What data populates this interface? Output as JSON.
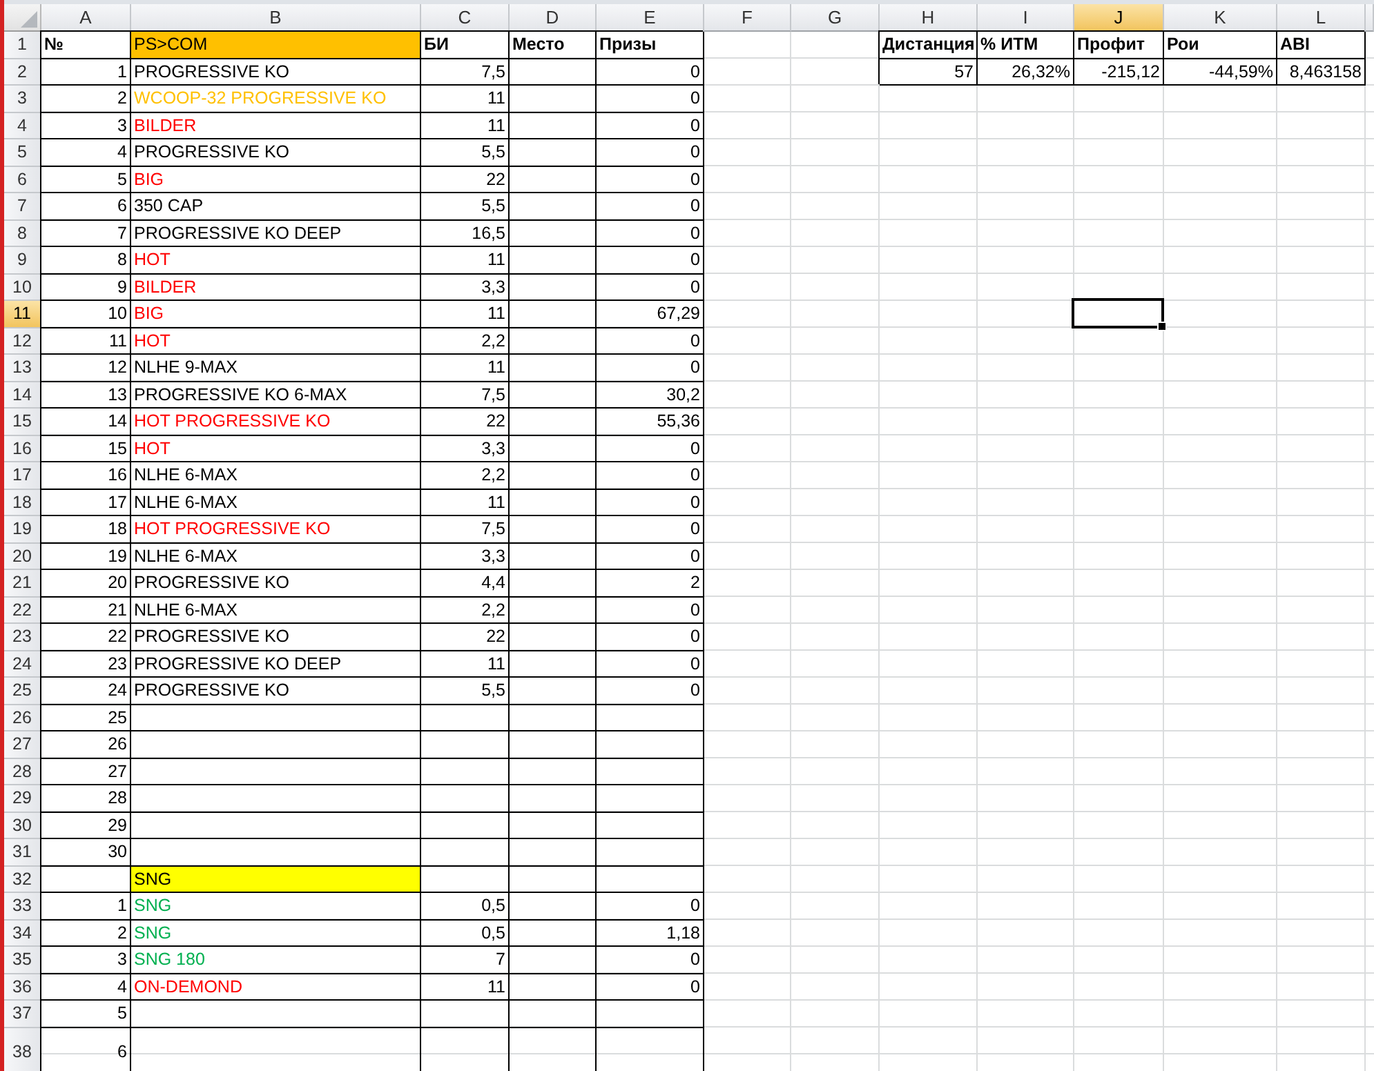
{
  "columns": [
    {
      "label": "A",
      "selected": false
    },
    {
      "label": "B",
      "selected": false
    },
    {
      "label": "C",
      "selected": false
    },
    {
      "label": "D",
      "selected": false
    },
    {
      "label": "E",
      "selected": false
    },
    {
      "label": "F",
      "selected": false
    },
    {
      "label": "G",
      "selected": false
    },
    {
      "label": "H",
      "selected": false
    },
    {
      "label": "I",
      "selected": false
    },
    {
      "label": "J",
      "selected": true
    },
    {
      "label": "K",
      "selected": false
    },
    {
      "label": "L",
      "selected": false
    }
  ],
  "rows": [
    {
      "number": "1",
      "selected": false,
      "cells": [
        {
          "text": "№",
          "kind": "text",
          "bold": true,
          "bordered": true
        },
        {
          "text": "PS>COM",
          "kind": "highlight",
          "color": "#ffc000",
          "bordered": true
        },
        {
          "text": "БИ",
          "kind": "text",
          "bold": true,
          "bordered": true
        },
        {
          "text": "Место",
          "kind": "text",
          "bold": true,
          "bordered": true
        },
        {
          "text": "Призы",
          "kind": "text",
          "bold": true,
          "bordered": true
        },
        {},
        {},
        {
          "text": "Дистанция",
          "kind": "text",
          "bold": true,
          "bordered": true
        },
        {
          "text": "% ИТМ",
          "kind": "text",
          "bold": true,
          "bordered": true
        },
        {
          "text": "Профит",
          "kind": "text",
          "bold": true,
          "bordered": true
        },
        {
          "text": "Рои",
          "kind": "text",
          "bold": true,
          "bordered": true
        },
        {
          "text": "ABI",
          "kind": "text",
          "bold": true,
          "bordered": true
        }
      ]
    },
    {
      "number": "2",
      "selected": false,
      "cells": [
        {
          "text": "1",
          "kind": "number",
          "bordered": true
        },
        {
          "text": "PROGRESSIVE KO",
          "kind": "text",
          "bordered": true
        },
        {
          "text": "7,5",
          "kind": "number",
          "bordered": true
        },
        {
          "bordered": true
        },
        {
          "text": "0",
          "kind": "number",
          "bordered": true
        },
        {},
        {},
        {
          "text": "57",
          "kind": "number",
          "bordered": true
        },
        {
          "text": "26,32%",
          "kind": "number",
          "bordered": true
        },
        {
          "text": "-215,12",
          "kind": "number",
          "bordered": true
        },
        {
          "text": "-44,59%",
          "kind": "number",
          "bordered": true
        },
        {
          "text": "8,463158",
          "kind": "number",
          "bordered": true
        }
      ]
    },
    {
      "number": "3",
      "selected": false,
      "cells": [
        {
          "text": "2",
          "kind": "number",
          "bordered": true
        },
        {
          "text": "WCOOP-32 PROGRESSIVE KO",
          "kind": "text",
          "color": "#ffc000",
          "bordered": true
        },
        {
          "text": "11",
          "kind": "number",
          "bordered": true
        },
        {
          "bordered": true
        },
        {
          "text": "0",
          "kind": "number",
          "bordered": true
        }
      ]
    },
    {
      "number": "4",
      "selected": false,
      "cells": [
        {
          "text": "3",
          "kind": "number",
          "bordered": true
        },
        {
          "text": "BILDER",
          "kind": "text",
          "color": "#ff0000",
          "bordered": true
        },
        {
          "text": "11",
          "kind": "number",
          "bordered": true
        },
        {
          "bordered": true
        },
        {
          "text": "0",
          "kind": "number",
          "bordered": true
        }
      ]
    },
    {
      "number": "5",
      "selected": false,
      "cells": [
        {
          "text": "4",
          "kind": "number",
          "bordered": true
        },
        {
          "text": "PROGRESSIVE KO",
          "kind": "text",
          "bordered": true
        },
        {
          "text": "5,5",
          "kind": "number",
          "bordered": true
        },
        {
          "bordered": true
        },
        {
          "text": "0",
          "kind": "number",
          "bordered": true
        }
      ]
    },
    {
      "number": "6",
      "selected": false,
      "cells": [
        {
          "text": "5",
          "kind": "number",
          "bordered": true
        },
        {
          "text": "BIG",
          "kind": "text",
          "color": "#ff0000",
          "bordered": true
        },
        {
          "text": "22",
          "kind": "number",
          "bordered": true
        },
        {
          "bordered": true
        },
        {
          "text": "0",
          "kind": "number",
          "bordered": true
        }
      ]
    },
    {
      "number": "7",
      "selected": false,
      "cells": [
        {
          "text": "6",
          "kind": "number",
          "bordered": true
        },
        {
          "text": "350 CAP",
          "kind": "text",
          "bordered": true
        },
        {
          "text": "5,5",
          "kind": "number",
          "bordered": true
        },
        {
          "bordered": true
        },
        {
          "text": "0",
          "kind": "number",
          "bordered": true
        }
      ]
    },
    {
      "number": "8",
      "selected": false,
      "cells": [
        {
          "text": "7",
          "kind": "number",
          "bordered": true
        },
        {
          "text": "PROGRESSIVE KO DEEP",
          "kind": "text",
          "bordered": true
        },
        {
          "text": "16,5",
          "kind": "number",
          "bordered": true
        },
        {
          "bordered": true
        },
        {
          "text": "0",
          "kind": "number",
          "bordered": true
        }
      ]
    },
    {
      "number": "9",
      "selected": false,
      "cells": [
        {
          "text": "8",
          "kind": "number",
          "bordered": true
        },
        {
          "text": "HOT",
          "kind": "text",
          "color": "#ff0000",
          "bordered": true
        },
        {
          "text": "11",
          "kind": "number",
          "bordered": true
        },
        {
          "bordered": true
        },
        {
          "text": "0",
          "kind": "number",
          "bordered": true
        }
      ]
    },
    {
      "number": "10",
      "selected": false,
      "cells": [
        {
          "text": "9",
          "kind": "number",
          "bordered": true
        },
        {
          "text": "BILDER",
          "kind": "text",
          "color": "#ff0000",
          "bordered": true
        },
        {
          "text": "3,3",
          "kind": "number",
          "bordered": true
        },
        {
          "bordered": true
        },
        {
          "text": "0",
          "kind": "number",
          "bordered": true
        }
      ]
    },
    {
      "number": "11",
      "selected": true,
      "cells": [
        {
          "text": "10",
          "kind": "number",
          "bordered": true
        },
        {
          "text": "BIG",
          "kind": "text",
          "color": "#ff0000",
          "bordered": true
        },
        {
          "text": "11",
          "kind": "number",
          "bordered": true
        },
        {
          "bordered": true
        },
        {
          "text": "67,29",
          "kind": "number",
          "bordered": true
        }
      ]
    },
    {
      "number": "12",
      "selected": false,
      "cells": [
        {
          "text": "11",
          "kind": "number",
          "bordered": true
        },
        {
          "text": "HOT",
          "kind": "text",
          "color": "#ff0000",
          "bordered": true
        },
        {
          "text": "2,2",
          "kind": "number",
          "bordered": true
        },
        {
          "bordered": true
        },
        {
          "text": "0",
          "kind": "number",
          "bordered": true
        }
      ]
    },
    {
      "number": "13",
      "selected": false,
      "cells": [
        {
          "text": "12",
          "kind": "number",
          "bordered": true
        },
        {
          "text": "NLHE 9-MAX",
          "kind": "text",
          "bordered": true
        },
        {
          "text": "11",
          "kind": "number",
          "bordered": true
        },
        {
          "bordered": true
        },
        {
          "text": "0",
          "kind": "number",
          "bordered": true
        }
      ]
    },
    {
      "number": "14",
      "selected": false,
      "cells": [
        {
          "text": "13",
          "kind": "number",
          "bordered": true
        },
        {
          "text": "PROGRESSIVE KO 6-MAX",
          "kind": "text",
          "bordered": true
        },
        {
          "text": "7,5",
          "kind": "number",
          "bordered": true
        },
        {
          "bordered": true
        },
        {
          "text": "30,2",
          "kind": "number",
          "bordered": true
        }
      ]
    },
    {
      "number": "15",
      "selected": false,
      "cells": [
        {
          "text": "14",
          "kind": "number",
          "bordered": true
        },
        {
          "text": "HOT PROGRESSIVE KO",
          "kind": "text",
          "color": "#ff0000",
          "bordered": true
        },
        {
          "text": "22",
          "kind": "number",
          "bordered": true
        },
        {
          "bordered": true
        },
        {
          "text": "55,36",
          "kind": "number",
          "bordered": true
        }
      ]
    },
    {
      "number": "16",
      "selected": false,
      "cells": [
        {
          "text": "15",
          "kind": "number",
          "bordered": true
        },
        {
          "text": "HOT",
          "kind": "text",
          "color": "#ff0000",
          "bordered": true
        },
        {
          "text": "3,3",
          "kind": "number",
          "bordered": true
        },
        {
          "bordered": true
        },
        {
          "text": "0",
          "kind": "number",
          "bordered": true
        }
      ]
    },
    {
      "number": "17",
      "selected": false,
      "cells": [
        {
          "text": "16",
          "kind": "number",
          "bordered": true
        },
        {
          "text": "NLHE 6-MAX",
          "kind": "text",
          "bordered": true
        },
        {
          "text": "2,2",
          "kind": "number",
          "bordered": true
        },
        {
          "bordered": true
        },
        {
          "text": "0",
          "kind": "number",
          "bordered": true
        }
      ]
    },
    {
      "number": "18",
      "selected": false,
      "cells": [
        {
          "text": "17",
          "kind": "number",
          "bordered": true
        },
        {
          "text": "NLHE 6-MAX",
          "kind": "text",
          "bordered": true
        },
        {
          "text": "11",
          "kind": "number",
          "bordered": true
        },
        {
          "bordered": true
        },
        {
          "text": "0",
          "kind": "number",
          "bordered": true
        }
      ]
    },
    {
      "number": "19",
      "selected": false,
      "cells": [
        {
          "text": "18",
          "kind": "number",
          "bordered": true
        },
        {
          "text": "HOT PROGRESSIVE KO",
          "kind": "text",
          "color": "#ff0000",
          "bordered": true
        },
        {
          "text": "7,5",
          "kind": "number",
          "bordered": true
        },
        {
          "bordered": true
        },
        {
          "text": "0",
          "kind": "number",
          "bordered": true
        }
      ]
    },
    {
      "number": "20",
      "selected": false,
      "cells": [
        {
          "text": "19",
          "kind": "number",
          "bordered": true
        },
        {
          "text": "NLHE 6-MAX",
          "kind": "text",
          "bordered": true
        },
        {
          "text": "3,3",
          "kind": "number",
          "bordered": true
        },
        {
          "bordered": true
        },
        {
          "text": "0",
          "kind": "number",
          "bordered": true
        }
      ]
    },
    {
      "number": "21",
      "selected": false,
      "cells": [
        {
          "text": "20",
          "kind": "number",
          "bordered": true
        },
        {
          "text": "PROGRESSIVE KO",
          "kind": "text",
          "bordered": true
        },
        {
          "text": "4,4",
          "kind": "number",
          "bordered": true
        },
        {
          "bordered": true
        },
        {
          "text": "2",
          "kind": "number",
          "bordered": true
        }
      ]
    },
    {
      "number": "22",
      "selected": false,
      "cells": [
        {
          "text": "21",
          "kind": "number",
          "bordered": true
        },
        {
          "text": "NLHE 6-MAX",
          "kind": "text",
          "bordered": true
        },
        {
          "text": "2,2",
          "kind": "number",
          "bordered": true
        },
        {
          "bordered": true
        },
        {
          "text": "0",
          "kind": "number",
          "bordered": true
        }
      ]
    },
    {
      "number": "23",
      "selected": false,
      "cells": [
        {
          "text": "22",
          "kind": "number",
          "bordered": true
        },
        {
          "text": "PROGRESSIVE KO",
          "kind": "text",
          "bordered": true
        },
        {
          "text": "22",
          "kind": "number",
          "bordered": true
        },
        {
          "bordered": true
        },
        {
          "text": "0",
          "kind": "number",
          "bordered": true
        }
      ]
    },
    {
      "number": "24",
      "selected": false,
      "cells": [
        {
          "text": "23",
          "kind": "number",
          "bordered": true
        },
        {
          "text": "PROGRESSIVE KO DEEP",
          "kind": "text",
          "bordered": true
        },
        {
          "text": "11",
          "kind": "number",
          "bordered": true
        },
        {
          "bordered": true
        },
        {
          "text": "0",
          "kind": "number",
          "bordered": true
        }
      ]
    },
    {
      "number": "25",
      "selected": false,
      "cells": [
        {
          "text": "24",
          "kind": "number",
          "bordered": true
        },
        {
          "text": "PROGRESSIVE KO",
          "kind": "text",
          "bordered": true
        },
        {
          "text": "5,5",
          "kind": "number",
          "bordered": true
        },
        {
          "bordered": true
        },
        {
          "text": "0",
          "kind": "number",
          "bordered": true
        }
      ]
    },
    {
      "number": "26",
      "selected": false,
      "cells": [
        {
          "text": "25",
          "kind": "number",
          "bordered": true
        },
        {
          "bordered": true
        },
        {
          "bordered": true
        },
        {
          "bordered": true
        },
        {
          "bordered": true
        }
      ]
    },
    {
      "number": "27",
      "selected": false,
      "cells": [
        {
          "text": "26",
          "kind": "number",
          "bordered": true
        },
        {
          "bordered": true
        },
        {
          "bordered": true
        },
        {
          "bordered": true
        },
        {
          "bordered": true
        }
      ]
    },
    {
      "number": "28",
      "selected": false,
      "cells": [
        {
          "text": "27",
          "kind": "number",
          "bordered": true
        },
        {
          "bordered": true
        },
        {
          "bordered": true
        },
        {
          "bordered": true
        },
        {
          "bordered": true
        }
      ]
    },
    {
      "number": "29",
      "selected": false,
      "cells": [
        {
          "text": "28",
          "kind": "number",
          "bordered": true
        },
        {
          "bordered": true
        },
        {
          "bordered": true
        },
        {
          "bordered": true
        },
        {
          "bordered": true
        }
      ]
    },
    {
      "number": "30",
      "selected": false,
      "cells": [
        {
          "text": "29",
          "kind": "number",
          "bordered": true
        },
        {
          "bordered": true
        },
        {
          "bordered": true
        },
        {
          "bordered": true
        },
        {
          "bordered": true
        }
      ]
    },
    {
      "number": "31",
      "selected": false,
      "cells": [
        {
          "text": "30",
          "kind": "number",
          "bordered": true
        },
        {
          "bordered": true
        },
        {
          "bordered": true
        },
        {
          "bordered": true
        },
        {
          "bordered": true
        }
      ]
    },
    {
      "number": "32",
      "selected": false,
      "cells": [
        {
          "bordered": true
        },
        {
          "text": "SNG",
          "kind": "highlight",
          "color": "#ffff00",
          "bordered": true
        },
        {
          "bordered": true
        },
        {
          "bordered": true
        },
        {
          "bordered": true
        }
      ]
    },
    {
      "number": "33",
      "selected": false,
      "cells": [
        {
          "text": "1",
          "kind": "number",
          "bordered": true
        },
        {
          "text": "SNG",
          "kind": "text",
          "color": "#00b050",
          "bordered": true
        },
        {
          "text": "0,5",
          "kind": "number",
          "bordered": true
        },
        {
          "bordered": true
        },
        {
          "text": "0",
          "kind": "number",
          "bordered": true
        }
      ]
    },
    {
      "number": "34",
      "selected": false,
      "cells": [
        {
          "text": "2",
          "kind": "number",
          "bordered": true
        },
        {
          "text": "SNG",
          "kind": "text",
          "color": "#00b050",
          "bordered": true
        },
        {
          "text": "0,5",
          "kind": "number",
          "bordered": true
        },
        {
          "bordered": true
        },
        {
          "text": "1,18",
          "kind": "number",
          "bordered": true
        }
      ]
    },
    {
      "number": "35",
      "selected": false,
      "cells": [
        {
          "text": "3",
          "kind": "number",
          "bordered": true
        },
        {
          "text": "SNG 180",
          "kind": "text",
          "color": "#00b050",
          "bordered": true
        },
        {
          "text": "7",
          "kind": "number",
          "bordered": true
        },
        {
          "bordered": true
        },
        {
          "text": "0",
          "kind": "number",
          "bordered": true
        }
      ]
    },
    {
      "number": "36",
      "selected": false,
      "cells": [
        {
          "text": "4",
          "kind": "number",
          "bordered": true
        },
        {
          "text": "ON-DEMOND",
          "kind": "text",
          "color": "#ff0000",
          "bordered": true
        },
        {
          "text": "11",
          "kind": "number",
          "bordered": true
        },
        {
          "bordered": true
        },
        {
          "text": "0",
          "kind": "number",
          "bordered": true
        }
      ]
    },
    {
      "number": "37",
      "selected": false,
      "cells": [
        {
          "text": "5",
          "kind": "number",
          "bordered": true
        },
        {
          "bordered": true
        },
        {
          "bordered": true
        },
        {
          "bordered": true
        },
        {
          "bordered": true
        }
      ]
    },
    {
      "number": "38",
      "selected": false,
      "cells": [
        {
          "text": "6",
          "kind": "number",
          "bordered": true
        },
        {
          "bordered": true
        },
        {
          "bordered": true
        },
        {
          "bordered": true
        },
        {
          "bordered": true
        }
      ]
    }
  ]
}
